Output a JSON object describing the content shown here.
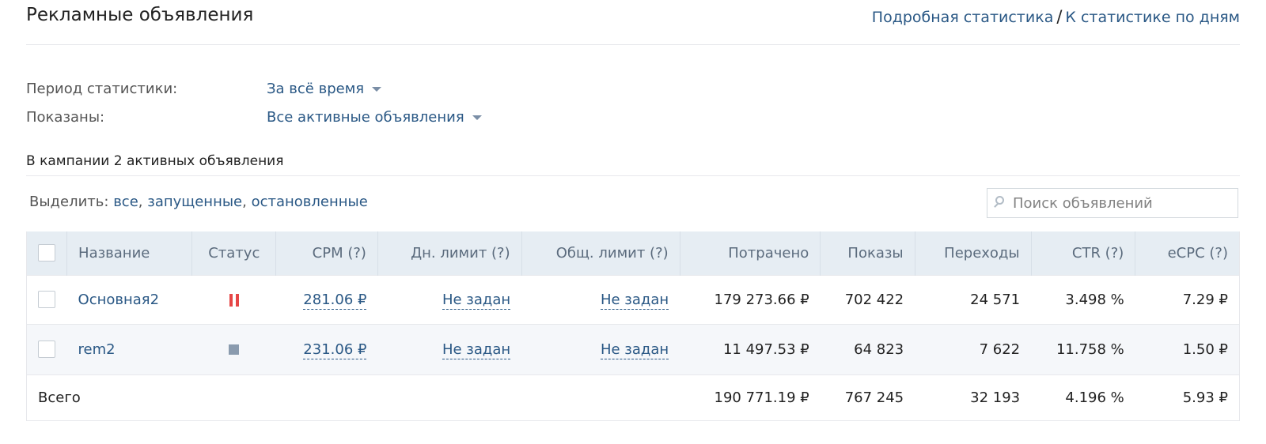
{
  "header": {
    "title": "Рекламные объявления",
    "link_detailed": "Подробная статистика",
    "separator": "/",
    "link_by_days": "К статистике по дням"
  },
  "filters": {
    "period_label": "Период статистики:",
    "period_value": "За всё время",
    "shown_label": "Показаны:",
    "shown_value": "Все активные объявления"
  },
  "summary": "В кампании 2 активных объявления",
  "select": {
    "label": "Выделить:",
    "all": "все",
    "comma1": ",",
    "running": "запущенные",
    "comma2": ",",
    "stopped": "остановленные"
  },
  "search": {
    "placeholder": "Поиск объявлений",
    "icon": "search-icon"
  },
  "table": {
    "columns": {
      "name": "Название",
      "status": "Статус",
      "cpm": "CPM (?)",
      "daily_limit": "Дн. лимит (?)",
      "total_limit": "Общ. лимит (?)",
      "spent": "Потрачено",
      "impressions": "Показы",
      "clicks": "Переходы",
      "ctr": "CTR (?)",
      "ecpc": "eCPC (?)"
    },
    "rows": [
      {
        "name": "Основная2",
        "status": "paused",
        "status_icon": "pause-icon",
        "status_color": "#e64646",
        "cpm": "281.06 ₽",
        "daily_limit": "Не задан",
        "total_limit": "Не задан",
        "spent": "179 273.66 ₽",
        "impressions": "702 422",
        "clicks": "24 571",
        "ctr": "3.498 %",
        "ecpc": "7.29 ₽"
      },
      {
        "name": "rem2",
        "status": "stopped",
        "status_icon": "stop-icon",
        "status_color": "#8a9bae",
        "cpm": "231.06 ₽",
        "daily_limit": "Не задан",
        "total_limit": "Не задан",
        "spent": "11 497.53 ₽",
        "impressions": "64 823",
        "clicks": "7 622",
        "ctr": "11.758 %",
        "ecpc": "1.50 ₽"
      }
    ],
    "total": {
      "label": "Всего",
      "spent": "190 771.19 ₽",
      "impressions": "767 245",
      "clicks": "32 193",
      "ctr": "4.196 %",
      "ecpc": "5.93 ₽"
    }
  },
  "colors": {
    "link": "#2a5885",
    "header_bg": "#e6edf3",
    "row_alt_bg": "#f5f7fa"
  }
}
